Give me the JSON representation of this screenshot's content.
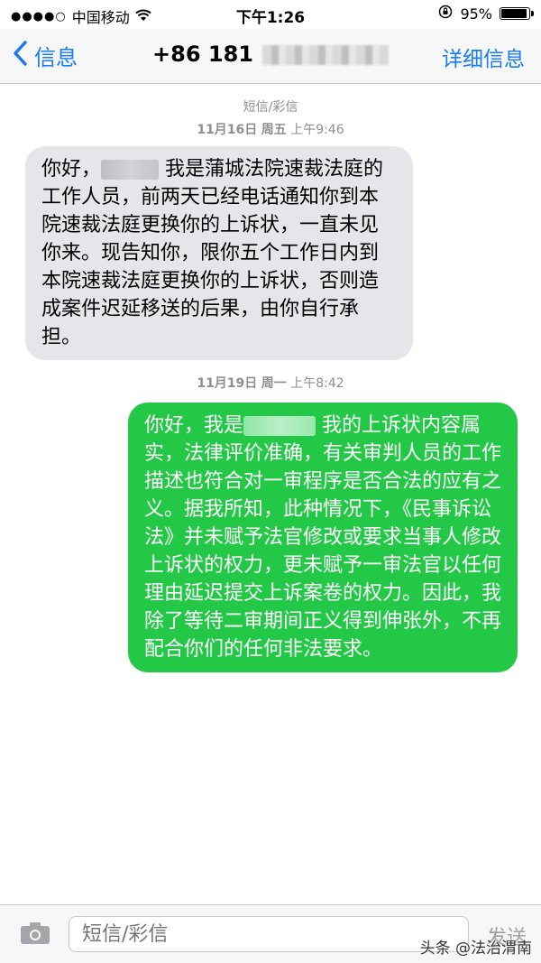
{
  "status_bar": {
    "signal": "●●●●○",
    "carrier": "中国移动",
    "time": "下午1:26",
    "battery_pct": "95%",
    "battery_level": 0.95
  },
  "nav": {
    "back_label": "信息",
    "contact_number": "+86 181",
    "details_label": "详细信息"
  },
  "messages": {
    "service_label": "短信/彩信",
    "date1": "11月16日",
    "day1": "周五",
    "time1": "上午9:46",
    "msg1_part1": "你好，",
    "msg1_part2": " 我是蒲城法院速裁法庭的工作人员，前两天已经电话通知你到本院速裁法庭更换你的上诉状，一直未见你来。现告知你，限你五个工作日内到本院速裁法庭更换你的上诉状，否则造成案件迟延移送的后果，由你自行承担。",
    "date2": "11月19日",
    "day2": "周一",
    "time2": "上午8:42",
    "msg2_part1": "你好，我是",
    "msg2_part2": " 我的上诉状内容属实，法律评价准确，有关审判人员的工作描述也符合对一审程序是否合法的应有之义。据我所知，此种情况下，《民事诉讼法》并未赋予法官修改或要求当事人修改上诉状的权力，更未赋予一审法官以任何理由延迟提交上诉案卷的权力。因此，我除了等待二审期间正义得到伸张外，不再配合你们的任何非法要求。"
  },
  "input": {
    "placeholder": "短信/彩信",
    "send_label": "发送"
  },
  "watermark": "头条 @法治渭南",
  "colors": {
    "accent": "#1a7cf5",
    "incoming_bubble": "#e5e5ea",
    "outgoing_bubble": "#24c847"
  }
}
